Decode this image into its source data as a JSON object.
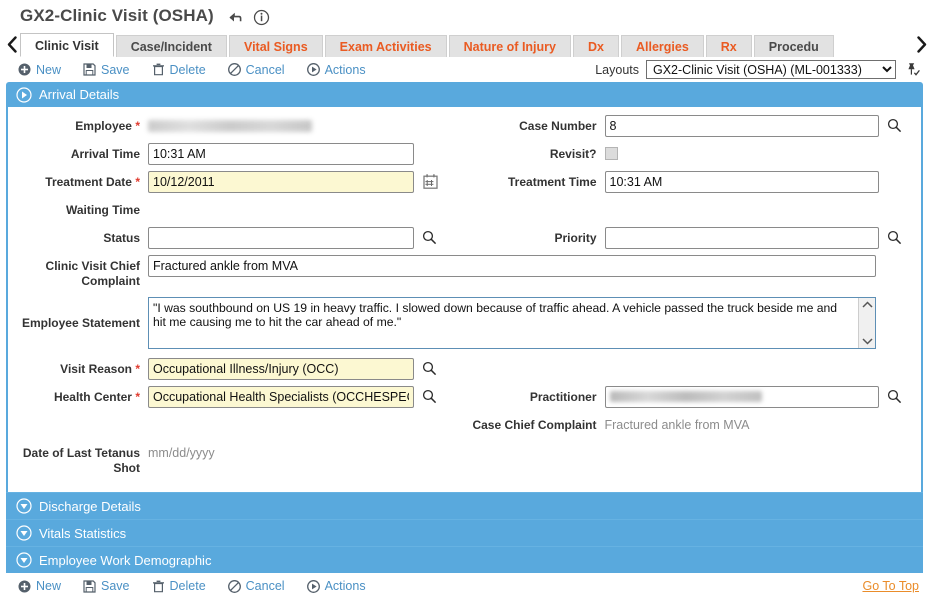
{
  "window": {
    "title": "GX2-Clinic Visit (OSHA)",
    "icons": [
      "return-arrow-icon",
      "info-icon"
    ]
  },
  "tabs": {
    "prev_label": "‹",
    "next_label": "›",
    "items": [
      {
        "label": "Clinic Visit",
        "active": true,
        "style": "active"
      },
      {
        "label": "Case/Incident",
        "active": false,
        "style": "neutral"
      },
      {
        "label": "Vital Signs",
        "active": false,
        "style": "orange"
      },
      {
        "label": "Exam Activities",
        "active": false,
        "style": "orange"
      },
      {
        "label": "Nature of Injury",
        "active": false,
        "style": "orange"
      },
      {
        "label": "Dx",
        "active": false,
        "style": "orange"
      },
      {
        "label": "Allergies",
        "active": false,
        "style": "orange"
      },
      {
        "label": "Rx",
        "active": false,
        "style": "orange"
      },
      {
        "label": "Procedu",
        "active": false,
        "style": "neutral"
      }
    ]
  },
  "toolbar": {
    "new_label": "New",
    "save_label": "Save",
    "delete_label": "Delete",
    "cancel_label": "Cancel",
    "actions_label": "Actions",
    "layouts_label": "Layouts",
    "layouts_value": "GX2-Clinic Visit (OSHA) (ML-001333)"
  },
  "sections": {
    "arrival": {
      "title": "Arrival Details",
      "expanded": true
    },
    "collapsed": [
      {
        "title": "Discharge Details"
      },
      {
        "title": "Vitals Statistics"
      },
      {
        "title": "Employee Work Demographic"
      }
    ]
  },
  "form": {
    "employee_label": "Employee",
    "employee_value": "",
    "case_number_label": "Case Number",
    "case_number_value": "8",
    "arrival_time_label": "Arrival Time",
    "arrival_time_value": "10:31 AM",
    "revisit_label": "Revisit?",
    "treatment_date_label": "Treatment Date",
    "treatment_date_value": "10/12/2011",
    "treatment_time_label": "Treatment Time",
    "treatment_time_value": "10:31 AM",
    "waiting_time_label": "Waiting Time",
    "waiting_time_value": "",
    "status_label": "Status",
    "status_value": "",
    "priority_label": "Priority",
    "priority_value": "",
    "chief_complaint_label": "Clinic Visit Chief Complaint",
    "chief_complaint_value": "Fractured ankle from MVA",
    "employee_statement_label": "Employee Statement",
    "employee_statement_value": "\"I was southbound on US 19 in heavy traffic. I slowed down because of traffic ahead. A vehicle passed the truck beside me and hit me causing me to hit the car ahead of me.\"",
    "visit_reason_label": "Visit Reason",
    "visit_reason_value": "Occupational Illness/Injury (OCC)",
    "health_center_label": "Health Center",
    "health_center_value": "Occupational Health Specialists (OCCHESPEC)",
    "practitioner_label": "Practitioner",
    "practitioner_value": "",
    "case_chief_complaint_label": "Case Chief Complaint",
    "case_chief_complaint_value": "Fractured ankle from MVA",
    "tetanus_label": "Date of Last Tetanus Shot",
    "tetanus_value": "mm/dd/yyyy"
  },
  "footer": {
    "new_label": "New",
    "save_label": "Save",
    "delete_label": "Delete",
    "cancel_label": "Cancel",
    "actions_label": "Actions",
    "go_to_top_label": "Go To Top"
  },
  "colors": {
    "panel_blue": "#59a9dd",
    "tab_orange": "#ea5b22",
    "link_blue": "#4a90c4",
    "required_red": "#e03b2f",
    "required_field_yellow": "#fcf8d2",
    "go_to_top_orange": "#ea8c2a"
  }
}
